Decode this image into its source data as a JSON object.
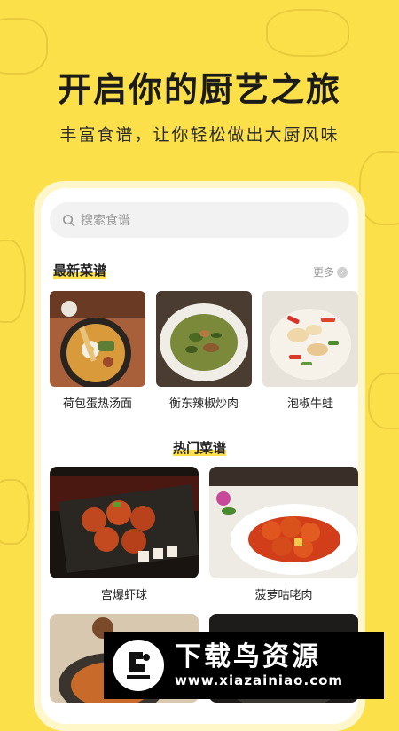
{
  "hero": {
    "title": "开启你的厨艺之旅",
    "subtitle": "丰富食谱，让你轻松做出大厨风味"
  },
  "search": {
    "placeholder": "搜索食谱",
    "icon": "search-icon"
  },
  "latest": {
    "title": "最新菜谱",
    "more_label": "更多",
    "items": [
      {
        "name": "荷包蛋热汤面"
      },
      {
        "name": "衡东辣椒炒肉"
      },
      {
        "name": "泡椒牛蛙"
      }
    ]
  },
  "hot": {
    "title": "热门菜谱",
    "items": [
      {
        "name": "宫爆虾球"
      },
      {
        "name": "菠萝咕咾肉"
      }
    ]
  },
  "watermark": {
    "title": "下载鸟资源",
    "url": "www.xiazainiao.com"
  },
  "colors": {
    "background": "#fbe04a",
    "accent": "#fbe04a",
    "text": "#222222"
  }
}
